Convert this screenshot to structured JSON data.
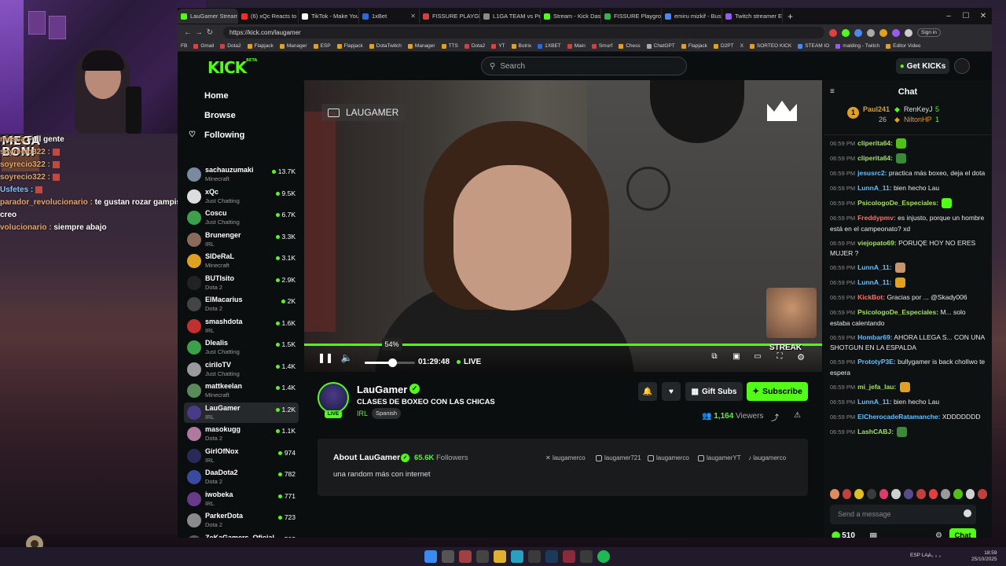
{
  "browser": {
    "tabs": [
      {
        "title": "LauGamer Stream",
        "color": "#53fc18"
      },
      {
        "title": "(6) xQc Reacts to Emir...",
        "color": "#ff2a2a"
      },
      {
        "title": "TikTok - Make Your Da...",
        "color": "#ffffff"
      },
      {
        "title": "1xBet",
        "color": "#2a6adf"
      },
      {
        "title": "FISSURE PLAYGROUND",
        "color": "#d04040"
      },
      {
        "title": "L1GA TEAM vs Peru Fi...",
        "color": "#8a8a8a"
      },
      {
        "title": "Stream - Kick Dashbo...",
        "color": "#53fc18"
      },
      {
        "title": "FISSURE Playground 2...",
        "color": "#3ab04a"
      },
      {
        "title": "emiru mizkif - Buscar...",
        "color": "#4a8af0"
      },
      {
        "title": "Twitch streamer Emiru...",
        "color": "#9a5af0"
      }
    ],
    "url": "https://kick.com/laugamer",
    "signin": "Sign in",
    "bookmarks": [
      "Gmail",
      "Dota2",
      "Flapjack",
      "Manager",
      "ESP",
      "Flapjack",
      "DotaTwitch",
      "Manager",
      "TTS",
      "Dota2",
      "YT",
      "Botrix",
      "1XBET",
      "Main",
      "Smurf",
      "Chess",
      "ChatGPT",
      "Flapjack",
      "D2PT",
      "X",
      "SORTEO KICK",
      "STEAM IO",
      "malding - Twitch",
      "Editor Video"
    ],
    "fb": "FB"
  },
  "kick": {
    "logo": "KICK",
    "logo_beta": "BETA",
    "search_placeholder": "Search",
    "get_kicks": "Get KICKs",
    "nav": {
      "home": "Home",
      "browse": "Browse",
      "following": "Following"
    },
    "channels": [
      {
        "name": "sachauzumaki",
        "category": "Minecraft",
        "viewers": "13.7K",
        "color": "#7a8aa0"
      },
      {
        "name": "xQc",
        "category": "Just Chatting",
        "viewers": "9.5K",
        "color": "#dddddd"
      },
      {
        "name": "Coscu",
        "category": "Just Chatting",
        "viewers": "6.7K",
        "color": "#3aa04a"
      },
      {
        "name": "Brunenger",
        "category": "IRL",
        "viewers": "3.3K",
        "color": "#8a6a5a"
      },
      {
        "name": "SIDeRaL",
        "category": "Minecraft",
        "viewers": "3.1K",
        "color": "#e0a020"
      },
      {
        "name": "BUTIsito",
        "category": "Dota 2",
        "viewers": "2.9K",
        "color": "#222222"
      },
      {
        "name": "ElMacarius",
        "category": "Dota 2",
        "viewers": "2K",
        "color": "#444444"
      },
      {
        "name": "smashdota",
        "category": "IRL",
        "viewers": "1.6K",
        "color": "#c03030"
      },
      {
        "name": "Dlealis",
        "category": "Just Chatting",
        "viewers": "1.5K",
        "color": "#3aa04a"
      },
      {
        "name": "cirilоTV",
        "category": "Just Chatting",
        "viewers": "1.4K",
        "color": "#9a9a9a"
      },
      {
        "name": "mattkeelan",
        "category": "Minecraft",
        "viewers": "1.4K",
        "color": "#5a8a5a"
      },
      {
        "name": "LauGamer",
        "category": "IRL",
        "viewers": "1.2K",
        "color": "#4a3a8a"
      },
      {
        "name": "masokugg",
        "category": "Dota 2",
        "viewers": "1.1K",
        "color": "#b07aa0"
      },
      {
        "name": "GirlOfNox",
        "category": "IRL",
        "viewers": "974",
        "color": "#2a2a5a"
      },
      {
        "name": "DaaDota2",
        "category": "Dota 2",
        "viewers": "782",
        "color": "#3a4aa0"
      },
      {
        "name": "iwobeka",
        "category": "IRL",
        "viewers": "771",
        "color": "#6a3a8a"
      },
      {
        "name": "ParkerDota",
        "category": "Dota 2",
        "viewers": "723",
        "color": "#8a8a8a"
      },
      {
        "name": "ZeKaGamers_Oficial",
        "category": "",
        "viewers": "503",
        "color": "#5a5a5a"
      }
    ],
    "player": {
      "watermark": "LAUGAMER",
      "volume_percent": 54,
      "volume_label": "54%",
      "time": "01:29:48",
      "live": "LIVE"
    },
    "stream": {
      "name": "LauGamer",
      "live_badge": "LIVE",
      "title": "CLASES DE BOXEO CON LAS CHICAS",
      "category": "IRL",
      "tag": "Spanish",
      "gift_subs": "Gift Subs",
      "subscribe": "Subscribe",
      "viewers_count": "1,164",
      "viewers_label": "Viewers"
    },
    "about": {
      "title": "About LauGamer",
      "followers_count": "65.6K",
      "followers_label": "Followers",
      "description": "una random más con internet",
      "socials": [
        "laugamerco",
        "laugamer721",
        "laugamerco",
        "laugamerYT",
        "laugamerco"
      ]
    },
    "chat": {
      "title": "Chat",
      "leaderboard": [
        {
          "rank": "1",
          "name": "Paul241",
          "count": "26"
        },
        {
          "name": "RenKeyJ",
          "count": "5"
        },
        {
          "name": "NiltonHP",
          "count": "1"
        }
      ],
      "messages": [
        {
          "time": "06:59 PM",
          "user": "cliperita64:",
          "color": "#a0e060",
          "text": ""
        },
        {
          "time": "06:59 PM",
          "user": "cliperita64:",
          "color": "#a0e060",
          "text": ""
        },
        {
          "time": "06:59 PM",
          "user": "jesusrc2:",
          "color": "#60c0ff",
          "text": "practica más boxeo, deja el dota"
        },
        {
          "time": "06:59 PM",
          "user": "LunnA_11:",
          "color": "#60c0ff",
          "text": "bien hecho Lau"
        },
        {
          "time": "06:59 PM",
          "user": "PsicologoDe_Especiales:",
          "color": "#a0e060",
          "text": ""
        },
        {
          "time": "06:59 PM",
          "user": "Freddypmv:",
          "color": "#ff7060",
          "text": "es injusto, porque un hombre está en el campeonato? xd"
        },
        {
          "time": "06:59 PM",
          "user": "viejopato69:",
          "color": "#a0e060",
          "text": "PORUQE HOY NO ERES MUJER ?"
        },
        {
          "time": "06:59 PM",
          "user": "LunnA_11:",
          "color": "#60c0ff",
          "text": ""
        },
        {
          "time": "06:59 PM",
          "user": "LunnA_11:",
          "color": "#60c0ff",
          "text": ""
        },
        {
          "time": "06:59 PM",
          "user": "KickBot:",
          "color": "#ff7060",
          "text": "Gracias por ... @Skady006"
        },
        {
          "time": "06:59 PM",
          "user": "PsicologoDe_Especiales:",
          "color": "#a0e060",
          "text": "M... solo estaba calentando"
        },
        {
          "time": "06:59 PM",
          "user": "Hombar69:",
          "color": "#60c0ff",
          "text": "AHORA LLEGA S... CON UNA SHOTGUN EN LA ESPALDA"
        },
        {
          "time": "06:59 PM",
          "user": "PrototyP3E:",
          "color": "#60c0ff",
          "text": "bullygamer is back cholIwo te espera"
        },
        {
          "time": "06:59 PM",
          "user": "mi_jefa_lau:",
          "color": "#a0e060",
          "text": ""
        },
        {
          "time": "06:59 PM",
          "user": "LunnA_11:",
          "color": "#60c0ff",
          "text": "bien hecho Lau"
        },
        {
          "time": "06:59 PM",
          "user": "ElCherocadeRatamanche:",
          "color": "#60c0ff",
          "text": "XDDDDDDD"
        },
        {
          "time": "06:59 PM",
          "user": "LashCABJ:",
          "color": "#a0e060",
          "text": ""
        }
      ],
      "meme_text": "STREAK",
      "input_placeholder": "Send a message",
      "points": "510",
      "send": "Chat"
    }
  },
  "overlay": {
    "mega": "MEGA BONI",
    "lines": [
      {
        "user": "mosca",
        "text": "Full gente"
      },
      {
        "user": "soyrecio322 :",
        "text": ""
      },
      {
        "user": "soyrecio322 :",
        "text": ""
      },
      {
        "user": "soyrecio322 :",
        "text": ""
      },
      {
        "user": "Usfetes :",
        "text": ""
      },
      {
        "user": "parador_revolucionario :",
        "text": "te gustan rozar gampis"
      },
      {
        "user": "",
        "text": "creo"
      },
      {
        "user": "volucionario :",
        "text": "siempre abajo"
      }
    ]
  },
  "taskbar": {
    "lang": "ESP LAA",
    "time": "18:59",
    "date": "25/10/2025"
  }
}
